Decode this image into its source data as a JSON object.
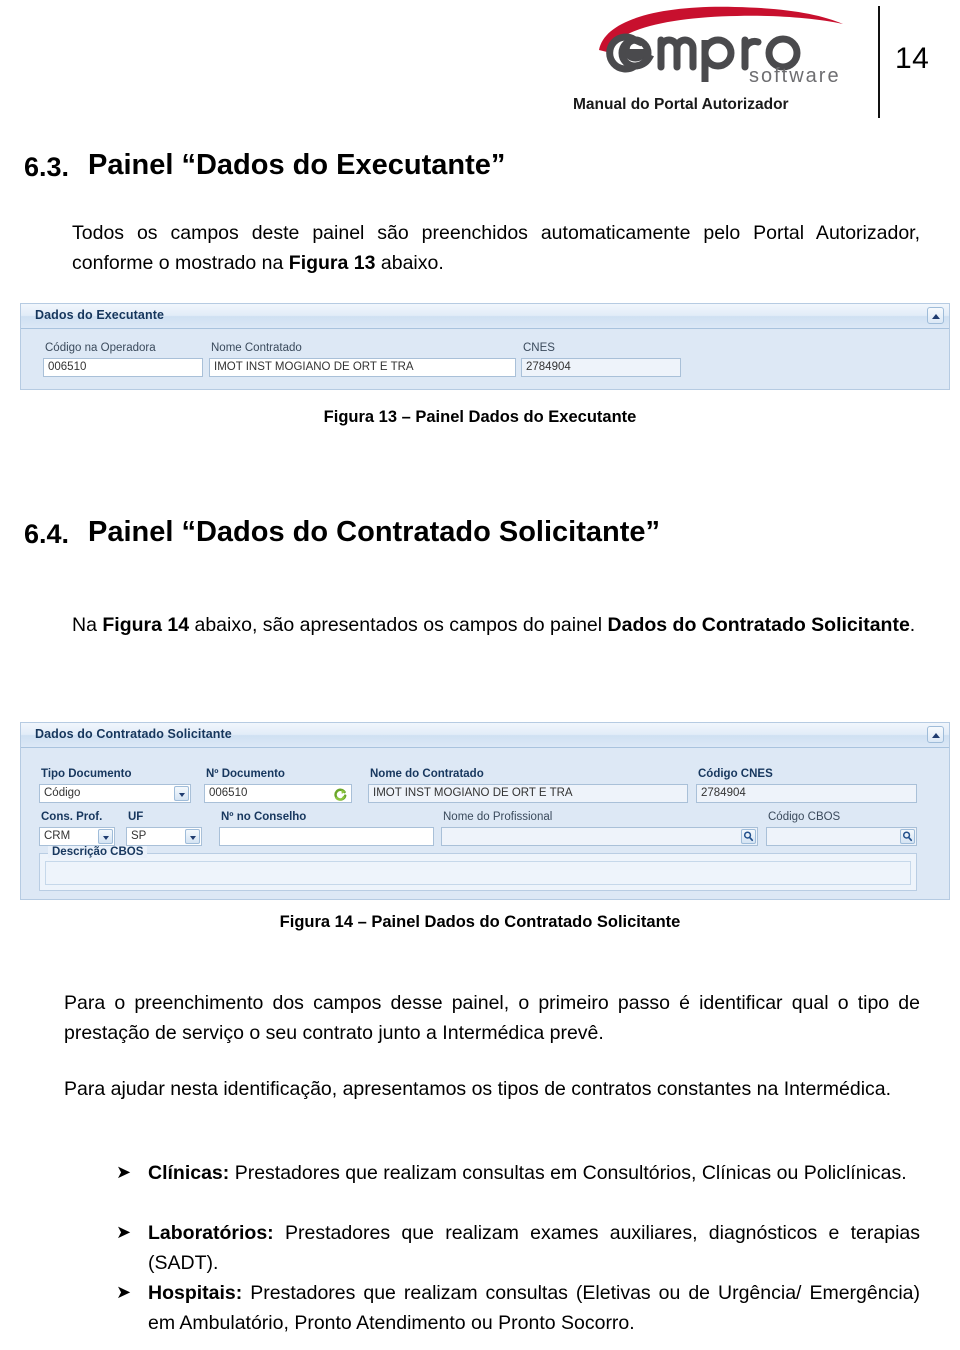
{
  "header": {
    "brand_name": "empro",
    "brand_sub": "software",
    "title": "Manual do Portal Autorizador",
    "page_number": "14",
    "brand_red": "#c8102e",
    "brand_gray": "#58585b"
  },
  "sections": [
    {
      "number": "6.3.",
      "title": "Painel “Dados do Executante”",
      "paragraph_html": "Todos os campos deste painel são preenchidos automaticamente pelo Portal Autorizador, conforme o mostrado na <b>Figura 13</b> abaixo."
    },
    {
      "number": "6.4.",
      "title": "Painel “Dados do Contratado Solicitante”",
      "paragraph_html": "Na <b>Figura 14</b> abaixo, são apresentados os campos do painel <b>Dados do Contratado Solicitante</b>."
    }
  ],
  "figure13": {
    "caption": "Figura 13 – Painel Dados do Executante",
    "panel_title": "Dados do Executante",
    "collapse_icon": "collapse-up-icon",
    "fields": [
      {
        "label": "Código na Operadora",
        "value": "006510",
        "type": "text"
      },
      {
        "label": "Nome Contratado",
        "value": "IMOT INST MOGIANO DE ORT E TRA",
        "type": "text"
      },
      {
        "label": "CNES",
        "value": "2784904",
        "type": "readonly"
      }
    ]
  },
  "figure14": {
    "caption": "Figura 14 – Painel Dados do Contratado Solicitante",
    "panel_title": "Dados do Contratado Solicitante",
    "collapse_icon": "collapse-up-icon",
    "row1": [
      {
        "label": "Tipo Documento",
        "value": "Código",
        "type": "combo"
      },
      {
        "label": "Nº Documento",
        "value": "006510",
        "type": "text-refresh"
      },
      {
        "label": "Nome do Contratado",
        "value": "IMOT INST MOGIANO DE ORT E TRA",
        "type": "readonly"
      },
      {
        "label": "Código CNES",
        "value": "2784904",
        "type": "readonly"
      }
    ],
    "row2": [
      {
        "label": "Cons. Prof.",
        "value": "CRM",
        "type": "combo"
      },
      {
        "label": "UF",
        "value": "SP",
        "type": "combo"
      },
      {
        "label": "Nº no Conselho",
        "value": "",
        "type": "text"
      },
      {
        "label": "Nome do Profissional",
        "value": "",
        "type": "text-search"
      },
      {
        "label": "Código CBOS",
        "value": "",
        "type": "text-search"
      }
    ],
    "group": {
      "legend": "Descrição CBOS",
      "value": ""
    }
  },
  "body": {
    "para3": "Para o preenchimento dos campos desse painel, o primeiro passo é identificar qual o tipo de prestação de serviço o seu contrato junto a Intermédica prevê.",
    "para4": "Para ajudar nesta identificação, apresentamos os tipos de contratos constantes na Intermédica."
  },
  "bullets": [
    {
      "marker": "➤",
      "term": "Clínicas:",
      "text": " Prestadores que realizam consultas em Consultórios, Clínicas ou Policlínicas."
    },
    {
      "marker": "➤",
      "term": "Laboratórios:",
      "text": " Prestadores que realizam exames auxiliares, diagnósticos e terapias (SADT)."
    },
    {
      "marker": "➤",
      "term": "Hospitais:",
      "text": " Prestadores que realizam consultas (Eletivas ou de Urgência/ Emergência) em Ambulatório, Pronto Atendimento ou Pronto Socorro."
    }
  ]
}
